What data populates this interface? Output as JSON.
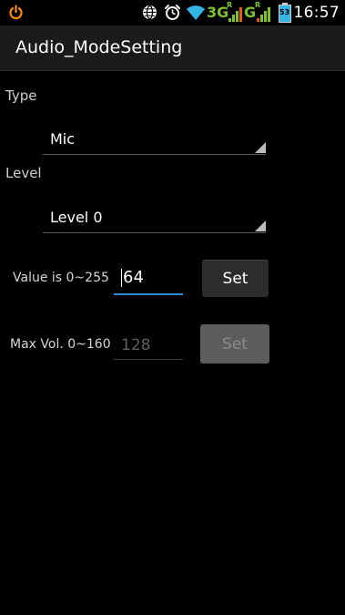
{
  "status_bar": {
    "time": "16:57",
    "network_3g": "3G",
    "network_g": "G",
    "superscript_r1": "R",
    "superscript_r2": "R",
    "battery_level": "53",
    "icons": [
      "power-icon",
      "globe-icon",
      "alarm-icon",
      "wifi-icon",
      "signal-3g-icon",
      "signal-g-icon",
      "battery-icon"
    ],
    "accent_color": "#ff8a00",
    "wifi_color": "#33b5e5",
    "signal_color": "#7cc22b"
  },
  "title_bar": {
    "title": "Audio_ModeSetting"
  },
  "type_section": {
    "label": "Type",
    "selected": "Mic"
  },
  "level_section": {
    "label": "Level",
    "selected": "Level 0"
  },
  "value_row": {
    "label": "Value is 0~255",
    "input_value": "64",
    "button_label": "Set"
  },
  "max_vol_row": {
    "label": "Max Vol. 0~160",
    "input_value": "128",
    "button_label": "Set"
  },
  "colors": {
    "background": "#000000",
    "title_bar": "#1b1b1b",
    "focus_underline": "#2a8bd8"
  }
}
